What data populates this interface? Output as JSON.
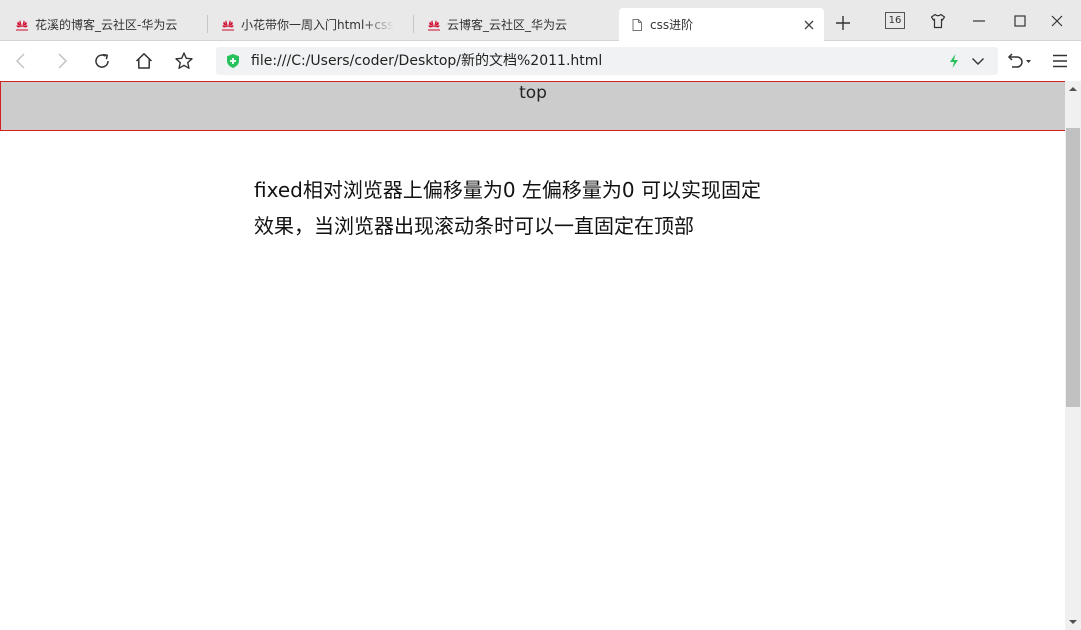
{
  "browser": {
    "tabs": [
      {
        "title": "花溪的博客_云社区-华为云",
        "favicon": "huawei-logo-icon",
        "active": false
      },
      {
        "title": "小花带你一周入门html+css",
        "favicon": "huawei-logo-icon",
        "active": false
      },
      {
        "title": "云博客_云社区_华为云",
        "favicon": "huawei-logo-icon",
        "active": false
      },
      {
        "title": "css进阶",
        "favicon": "page-icon",
        "active": true
      }
    ],
    "tab_count": "16",
    "address": {
      "url": "file:///C:/Users/coder/Desktop/新的文档%2011.html"
    },
    "icons": {
      "back": "back-arrow-icon",
      "forward": "forward-arrow-icon",
      "reload": "reload-icon",
      "home": "home-icon",
      "bookmark": "star-icon",
      "security": "shield-icon",
      "speed": "lightning-icon",
      "menu": "hamburger-menu-icon"
    },
    "colors": {
      "security_green": "#27c25b",
      "tab_strip": "#e9e9ea",
      "huawei_red": "#cf0a2c"
    }
  },
  "page": {
    "top_bar": {
      "label": "top",
      "background": "#cccccc",
      "border_color": "#d22222"
    },
    "content": "fixed相对浏览器上偏移量为0 左偏移量为0 可以实现固定效果，当浏览器出现滚动条时可以一直固定在顶部"
  }
}
